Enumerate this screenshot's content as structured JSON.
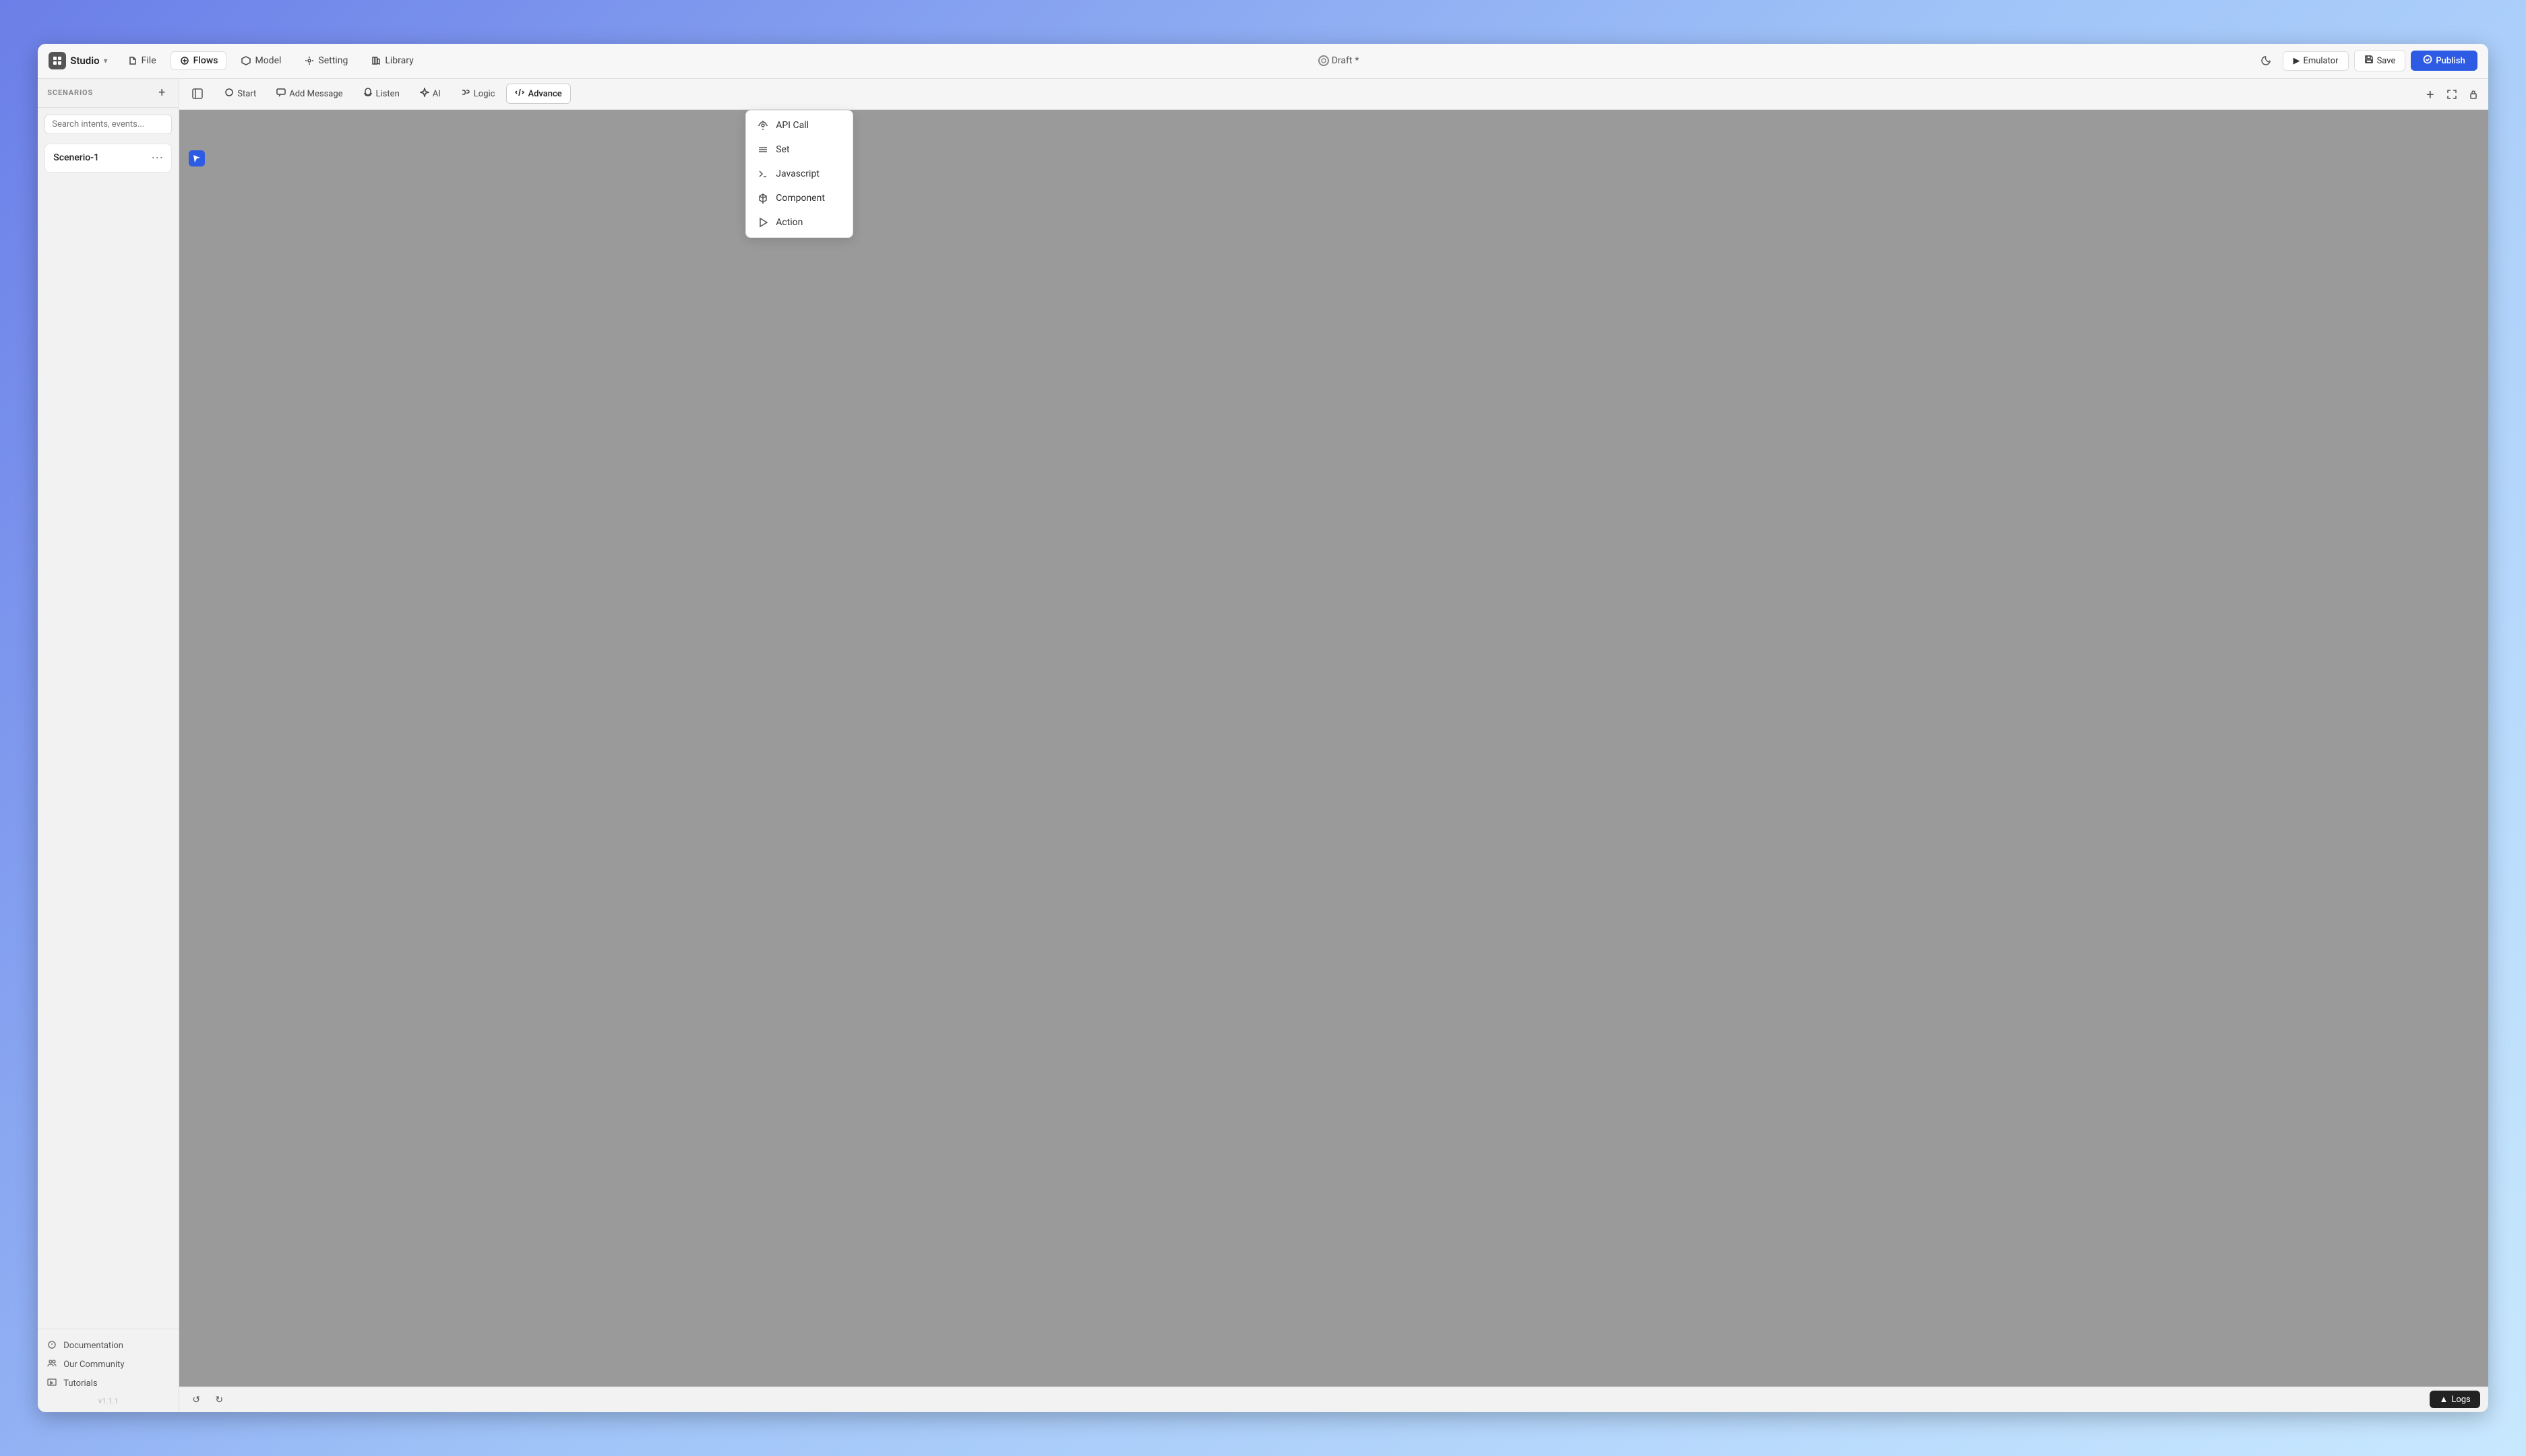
{
  "app": {
    "title": "Studio",
    "version": "v1.1.1"
  },
  "header": {
    "nav_items": [
      {
        "id": "file",
        "label": "File",
        "icon": "file",
        "active": false
      },
      {
        "id": "flows",
        "label": "Flows",
        "icon": "flows",
        "active": true
      },
      {
        "id": "model",
        "label": "Model",
        "icon": "model",
        "active": false
      },
      {
        "id": "setting",
        "label": "Setting",
        "icon": "setting",
        "active": false
      },
      {
        "id": "library",
        "label": "Library",
        "icon": "library",
        "active": false
      }
    ],
    "draft_label": "Draft",
    "draft_star": "*",
    "emulator_label": "Emulator",
    "save_label": "Save",
    "publish_label": "Publish"
  },
  "sidebar": {
    "title": "SCENARIOS",
    "search_placeholder": "Search intents, events...",
    "scenarios": [
      {
        "id": "scenario-1",
        "name": "Scenerio-1"
      }
    ],
    "footer_links": [
      {
        "id": "documentation",
        "label": "Documentation"
      },
      {
        "id": "community",
        "label": "Our Community"
      },
      {
        "id": "tutorials",
        "label": "Tutorials"
      }
    ],
    "version": "v1.1.1"
  },
  "canvas": {
    "toolbar_items": [
      {
        "id": "start",
        "label": "Start",
        "icon": "circle"
      },
      {
        "id": "add-message",
        "label": "Add Message",
        "icon": "message"
      },
      {
        "id": "listen",
        "label": "Listen",
        "icon": "headphone"
      },
      {
        "id": "ai",
        "label": "AI",
        "icon": "ai"
      },
      {
        "id": "logic",
        "label": "Logic",
        "icon": "logic"
      },
      {
        "id": "advance",
        "label": "Advance",
        "icon": "code",
        "active": true
      }
    ],
    "advance_menu": {
      "items": [
        {
          "id": "api-call",
          "label": "API Call",
          "icon": "api"
        },
        {
          "id": "set",
          "label": "Set",
          "icon": "set"
        },
        {
          "id": "javascript",
          "label": "Javascript",
          "icon": "js"
        },
        {
          "id": "component",
          "label": "Component",
          "icon": "component"
        },
        {
          "id": "action",
          "label": "Action",
          "icon": "action"
        }
      ]
    }
  },
  "bottom": {
    "logs_label": "Logs"
  }
}
